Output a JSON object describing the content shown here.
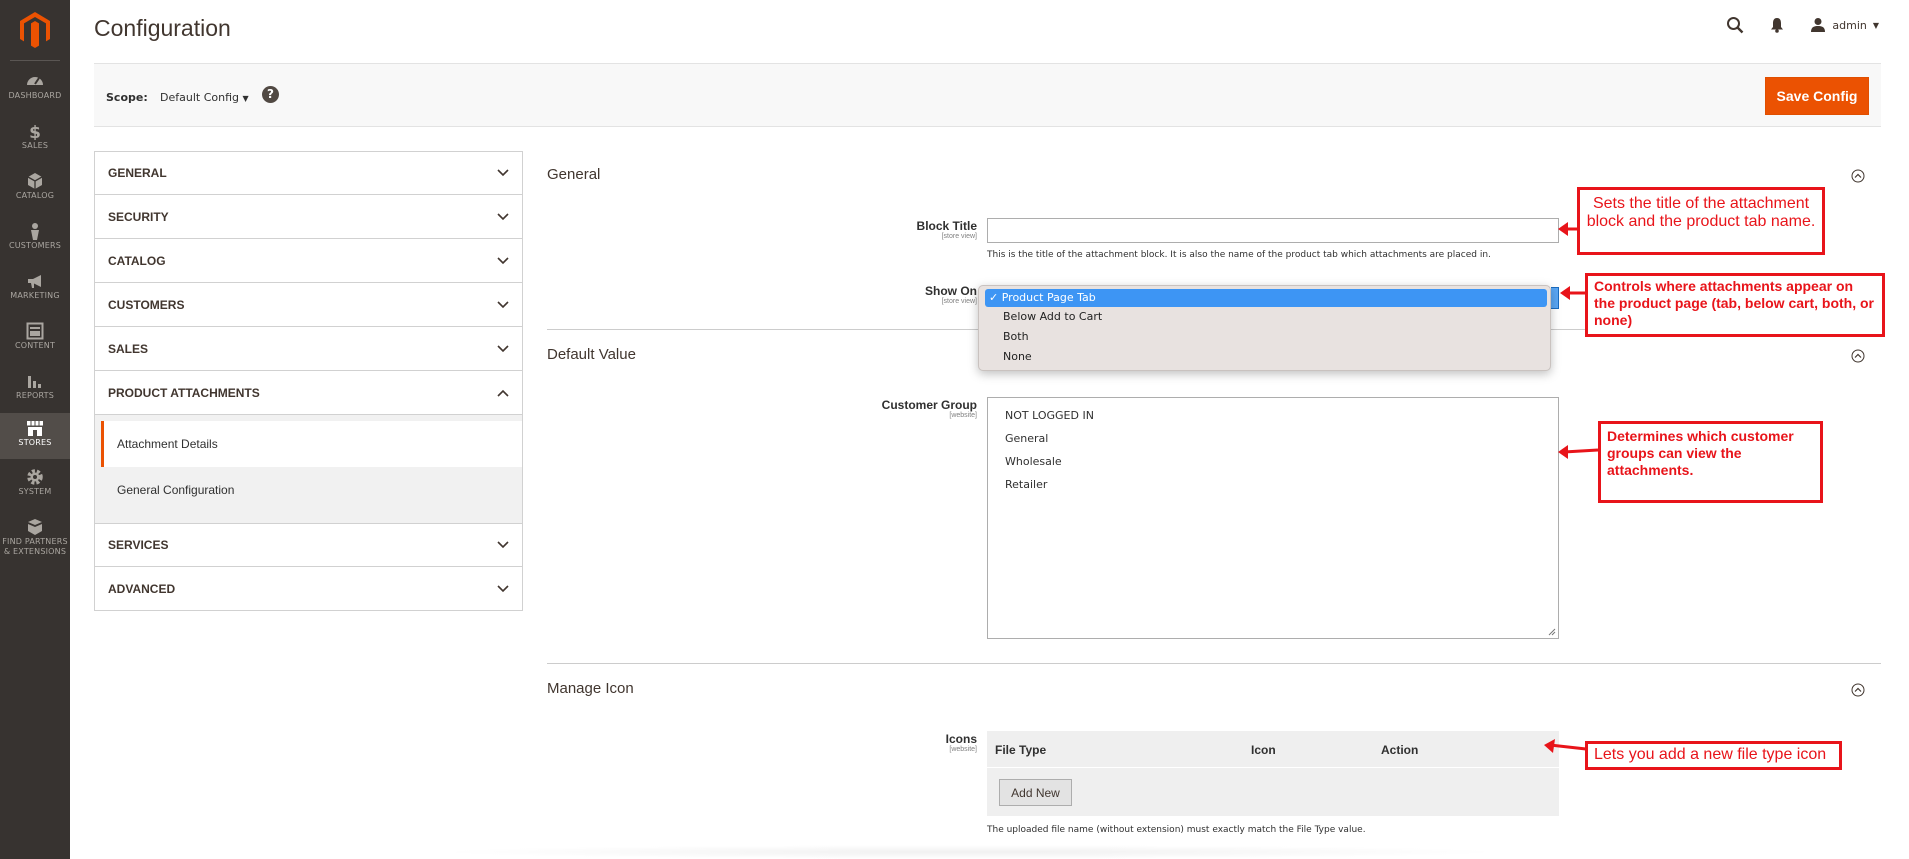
{
  "admin_menu": [
    {
      "label": "DASHBOARD",
      "icon": "speedometer-icon"
    },
    {
      "label": "SALES",
      "icon": "dollar-icon"
    },
    {
      "label": "CATALOG",
      "icon": "cube-icon"
    },
    {
      "label": "CUSTOMERS",
      "icon": "person-icon"
    },
    {
      "label": "MARKETING",
      "icon": "megaphone-icon"
    },
    {
      "label": "CONTENT",
      "icon": "layout-icon"
    },
    {
      "label": "REPORTS",
      "icon": "bar-chart-icon"
    },
    {
      "label": "STORES",
      "icon": "storefront-icon",
      "active": true
    },
    {
      "label": "SYSTEM",
      "icon": "gear-icon"
    },
    {
      "label": "FIND PARTNERS & EXTENSIONS",
      "icon": "box-stack-icon"
    }
  ],
  "header": {
    "title": "Configuration",
    "user": "admin"
  },
  "scope_bar": {
    "label": "Scope:",
    "value": "Default Config",
    "help": "?",
    "save_label": "Save Config"
  },
  "config_tabs": {
    "general": "GENERAL",
    "security": "SECURITY",
    "catalog": "CATALOG",
    "customers": "CUSTOMERS",
    "sales": "SALES",
    "product_attachments": "PRODUCT ATTACHMENTS",
    "sub_items": [
      "Attachment Details",
      "General Configuration"
    ],
    "services": "SERVICES",
    "advanced": "ADVANCED"
  },
  "sections": {
    "general": {
      "title": "General",
      "block_title_label": "Block Title",
      "block_title_scope": "[store view]",
      "block_title_value": "",
      "block_title_note": "This is the title of the attachment block. It is also the name of the product tab which attachments are placed in.",
      "show_on_label": "Show On",
      "show_on_scope": "[store view]",
      "show_on_options": [
        "Product Page Tab",
        "Below Add to Cart",
        "Both",
        "None"
      ],
      "show_on_selected_mark": "✓"
    },
    "default_value": {
      "title": "Default Value",
      "customer_group_label": "Customer Group",
      "customer_group_scope": "[website]",
      "customer_group_options": [
        "NOT LOGGED IN",
        "General",
        "Wholesale",
        "Retailer"
      ]
    },
    "manage_icon": {
      "title": "Manage Icon",
      "icons_label": "Icons",
      "icons_scope": "[website]",
      "columns": [
        "File Type",
        "Icon",
        "Action"
      ],
      "add_new_label": "Add New",
      "note": "The uploaded file name (without extension) must exactly match the File Type value."
    }
  },
  "annotations": {
    "block_title": "Sets the title of the attachment block and the product tab name.",
    "show_on": "Controls where attachments appear on the product page (tab, below cart, both, or none)",
    "customer_group": " Determines which customer groups can view the attachments.",
    "icons": "Lets you add a new file type icon"
  },
  "colors": {
    "menu_bg": "#373330",
    "accent": "#eb5202",
    "annotation": "#e8141a",
    "selection": "#3d95f4"
  }
}
